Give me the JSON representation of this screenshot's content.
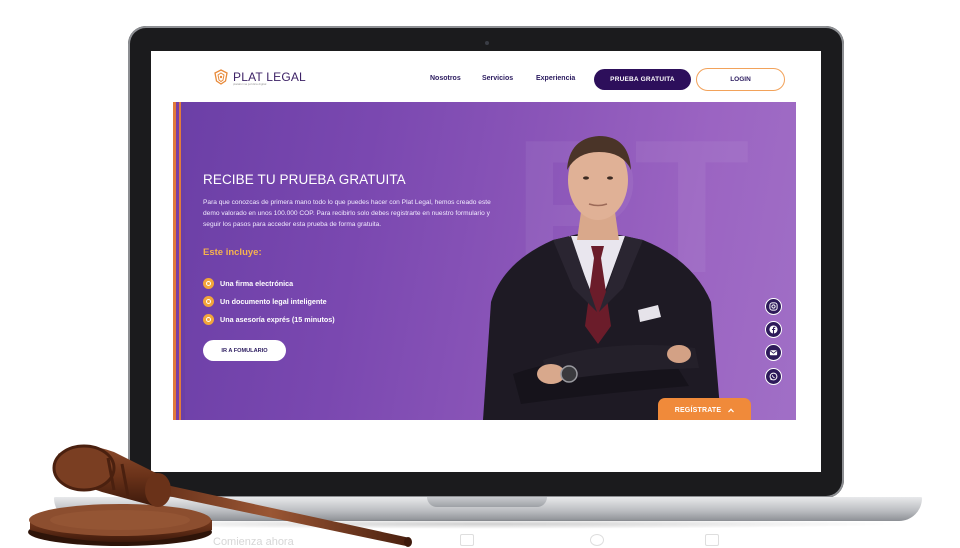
{
  "site": {
    "logo_text": "PLAT LEGAL",
    "logo_tagline": "plataforma jurídica digital",
    "nav": [
      "Nosotros",
      "Servicios",
      "Experiencia"
    ],
    "trial_button": "PRUEBA GRATUITA",
    "login_button": "LOGIN"
  },
  "hero": {
    "title": "RECIBE TU PRUEBA GRATUITA",
    "description": "Para que conozcas de primera mano todo lo que puedes hacer con Plat Legal, hemos creado este demo valorado en unos 100.000 COP. Para recibirlo solo debes registrarte en nuestro formulario y seguir los pasos para acceder esta prueba de forma gratuita.",
    "includes_title": "Este incluye:",
    "features": [
      "Una firma electrónica",
      "Un documento legal inteligente",
      "Una asesoría exprés (15 minutos)"
    ],
    "form_button": "IR A FOMULARIO",
    "watermark": "PT"
  },
  "social": [
    "instagram-icon",
    "facebook-icon",
    "email-icon",
    "whatsapp-icon"
  ],
  "register_button": "REGÍSTRATE",
  "footer_faded_text": "Comienza ahora",
  "colors": {
    "brand_purple": "#2d0f5b",
    "hero_purple": "#7a48b0",
    "accent_orange": "#f08a3a",
    "accent_yellow": "#f6b24e"
  }
}
